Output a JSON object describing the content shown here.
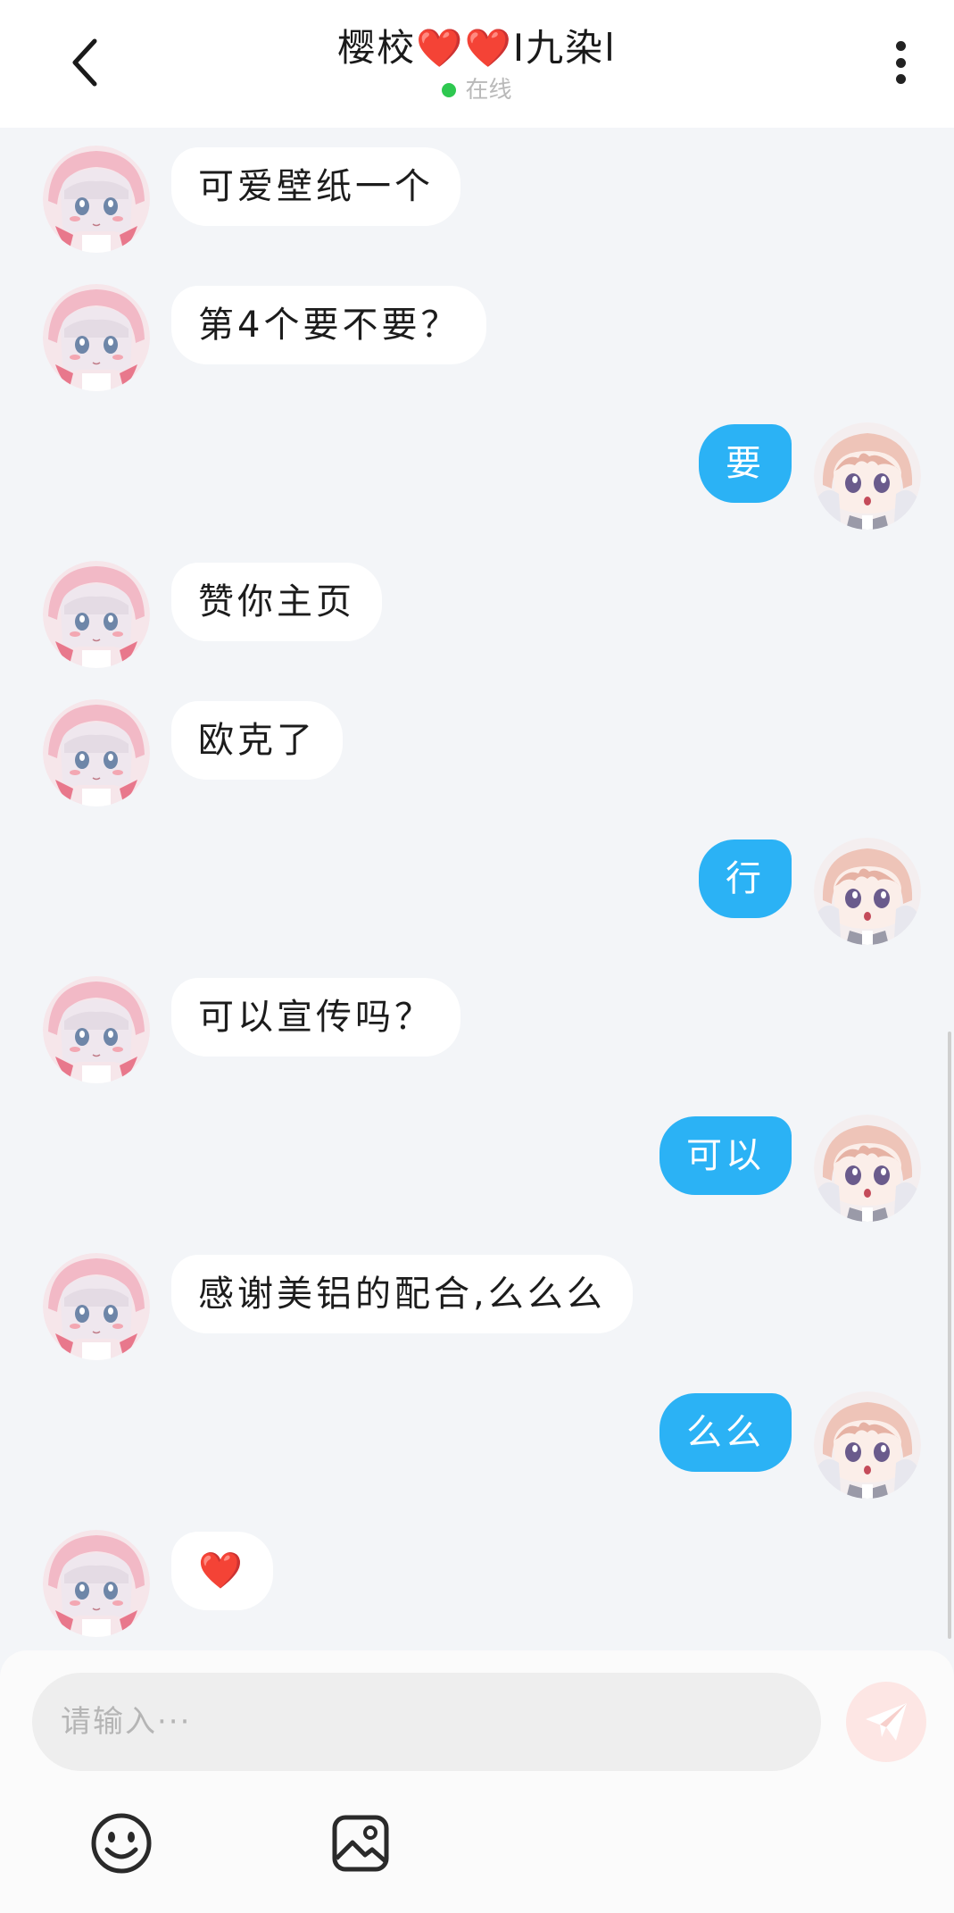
{
  "header": {
    "title": "樱校❤️❤️I九染l",
    "status": "在线"
  },
  "messages": [
    {
      "side": "left",
      "text": "可爱壁纸一个"
    },
    {
      "side": "left",
      "text": "第4个要不要？"
    },
    {
      "side": "right",
      "text": "要"
    },
    {
      "side": "left",
      "text": "赞你主页"
    },
    {
      "side": "left",
      "text": "欧克了"
    },
    {
      "side": "right",
      "text": "行"
    },
    {
      "side": "left",
      "text": "可以宣传吗？"
    },
    {
      "side": "right",
      "text": "可以"
    },
    {
      "side": "left",
      "text": "感谢美铝的配合,么么么"
    },
    {
      "side": "right",
      "text": "么么"
    },
    {
      "side": "left",
      "text": "❤️"
    }
  ],
  "input": {
    "placeholder": "请输入···",
    "value": ""
  },
  "icons": {
    "back": "chevron-left-icon",
    "more": "more-vertical-icon",
    "send": "paper-plane-icon",
    "emoji": "smiley-icon",
    "image": "image-icon"
  },
  "colors": {
    "outgoing_bubble": "#2bb2f5",
    "incoming_bubble": "#ffffff",
    "background": "#f3f5f8",
    "online_dot": "#2ec850",
    "send_button": "#fde6e4"
  }
}
